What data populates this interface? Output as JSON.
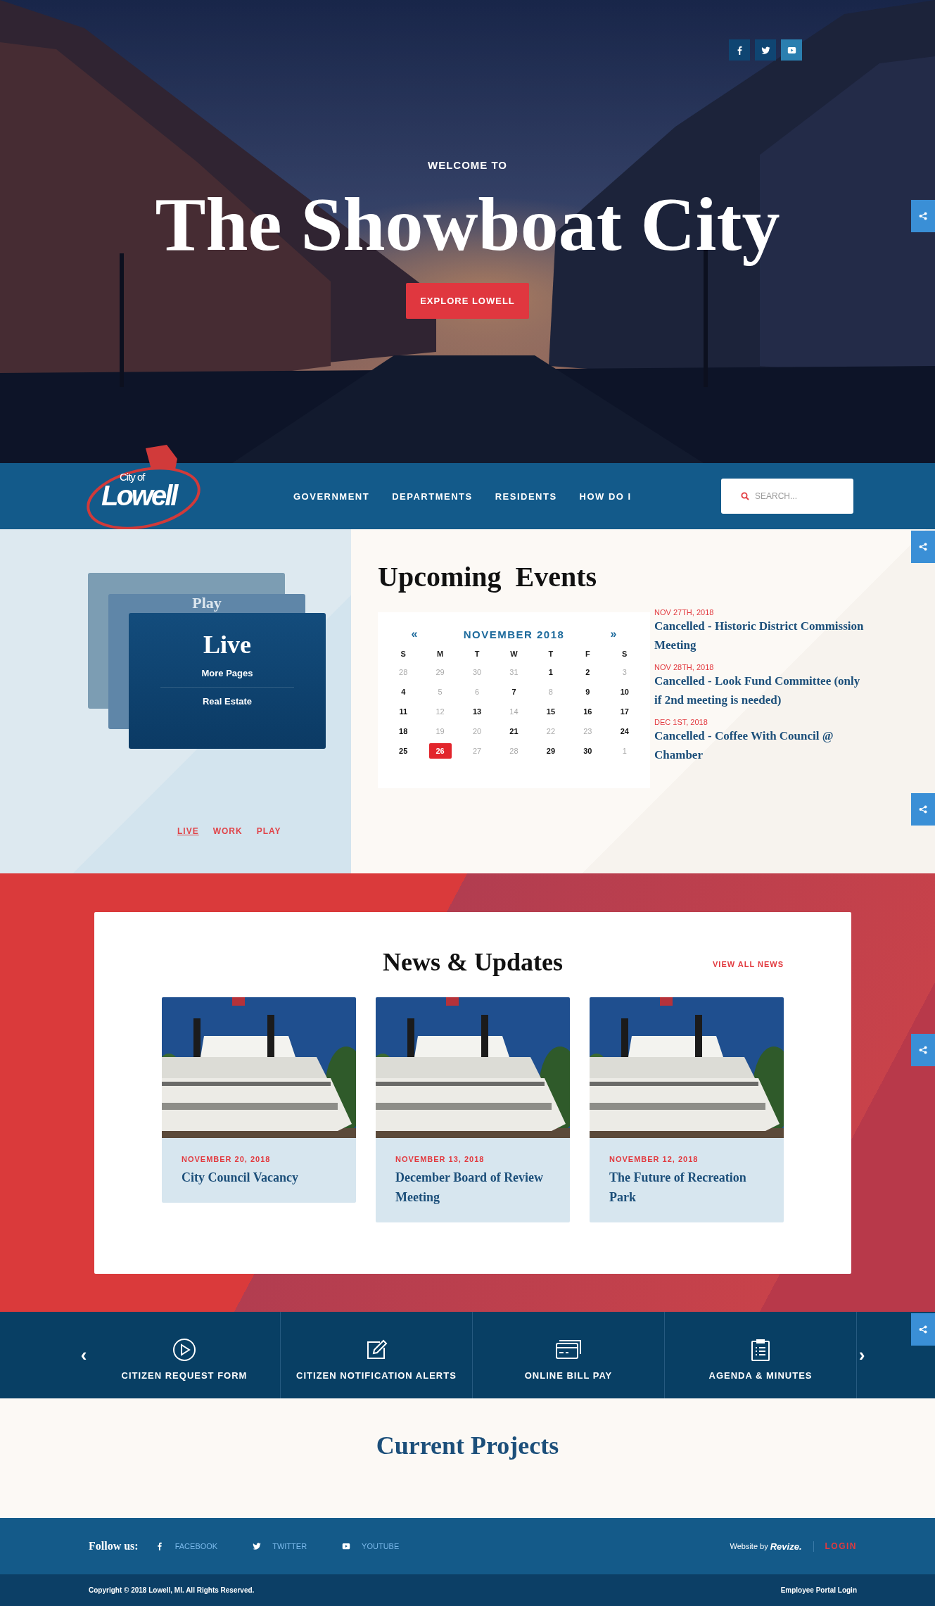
{
  "hero": {
    "social": [
      {
        "kind": "facebook"
      },
      {
        "kind": "twitter"
      },
      {
        "kind": "youtube"
      }
    ],
    "eyebrow": "WELCOME TO",
    "title": "The Showboat City",
    "button": "EXPLORE LOWELL"
  },
  "header": {
    "logo": {
      "small": "City of",
      "large": "Lowell"
    },
    "nav": [
      {
        "label": "GOVERNMENT"
      },
      {
        "label": "DEPARTMENTS"
      },
      {
        "label": "RESIDENTS"
      },
      {
        "label": "HOW DO I"
      }
    ],
    "search": {
      "placeholder": "SEARCH..."
    }
  },
  "explore": {
    "back_card_title": "Play",
    "front_card": {
      "title": "Live",
      "links": [
        "More Pages",
        "Real Estate"
      ]
    },
    "tabs": [
      {
        "label": "LIVE",
        "selected": true
      },
      {
        "label": "WORK",
        "selected": false
      },
      {
        "label": "PLAY",
        "selected": false
      }
    ]
  },
  "events": {
    "title": "Upcoming  Events",
    "calendar": {
      "prev": "«",
      "month": "NOVEMBER 2018",
      "next": "»",
      "weekdays": [
        "S",
        "M",
        "T",
        "W",
        "T",
        "F",
        "S"
      ],
      "days": [
        {
          "day": "28",
          "has_events": false,
          "selected": false
        },
        {
          "day": "29",
          "has_events": false,
          "selected": false
        },
        {
          "day": "30",
          "has_events": false,
          "selected": false
        },
        {
          "day": "31",
          "has_events": false,
          "selected": false
        },
        {
          "day": "1",
          "has_events": true,
          "selected": false
        },
        {
          "day": "2",
          "has_events": true,
          "selected": false
        },
        {
          "day": "3",
          "has_events": false,
          "selected": false
        },
        {
          "day": "4",
          "has_events": true,
          "selected": false
        },
        {
          "day": "5",
          "has_events": false,
          "selected": false
        },
        {
          "day": "6",
          "has_events": false,
          "selected": false
        },
        {
          "day": "7",
          "has_events": true,
          "selected": false
        },
        {
          "day": "8",
          "has_events": false,
          "selected": false
        },
        {
          "day": "9",
          "has_events": true,
          "selected": false
        },
        {
          "day": "10",
          "has_events": true,
          "selected": false
        },
        {
          "day": "11",
          "has_events": true,
          "selected": false
        },
        {
          "day": "12",
          "has_events": false,
          "selected": false
        },
        {
          "day": "13",
          "has_events": true,
          "selected": false
        },
        {
          "day": "14",
          "has_events": false,
          "selected": false
        },
        {
          "day": "15",
          "has_events": true,
          "selected": false
        },
        {
          "day": "16",
          "has_events": true,
          "selected": false
        },
        {
          "day": "17",
          "has_events": true,
          "selected": false
        },
        {
          "day": "18",
          "has_events": true,
          "selected": false
        },
        {
          "day": "19",
          "has_events": false,
          "selected": false
        },
        {
          "day": "20",
          "has_events": false,
          "selected": false
        },
        {
          "day": "21",
          "has_events": true,
          "selected": false
        },
        {
          "day": "22",
          "has_events": false,
          "selected": false
        },
        {
          "day": "23",
          "has_events": false,
          "selected": false
        },
        {
          "day": "24",
          "has_events": true,
          "selected": false
        },
        {
          "day": "25",
          "has_events": true,
          "selected": false
        },
        {
          "day": "26",
          "has_events": true,
          "selected": true
        },
        {
          "day": "27",
          "has_events": false,
          "selected": false
        },
        {
          "day": "28",
          "has_events": false,
          "selected": false
        },
        {
          "day": "29",
          "has_events": true,
          "selected": false
        },
        {
          "day": "30",
          "has_events": true,
          "selected": false
        },
        {
          "day": "1",
          "has_events": false,
          "selected": false
        }
      ]
    },
    "items": [
      {
        "date": "NOV 27TH, 2018",
        "title": "Cancelled - Historic District Commission Meeting"
      },
      {
        "date": "NOV 28TH, 2018",
        "title": "Cancelled - Look Fund Committee (only if 2nd meeting is needed)"
      },
      {
        "date": "DEC 1ST, 2018",
        "title": "Cancelled - Coffee With Council @ Chamber"
      }
    ]
  },
  "news": {
    "title": "News & Updates",
    "view_all": "VIEW ALL NEWS",
    "articles": [
      {
        "date": "NOVEMBER 20, 2018",
        "title": "City Council Vacancy"
      },
      {
        "date": "NOVEMBER 13, 2018",
        "title": "December Board of Review Meeting"
      },
      {
        "date": "NOVEMBER 12, 2018",
        "title": "The Future of Recreation Park"
      }
    ]
  },
  "quick_links": {
    "prev": "‹",
    "next": "›",
    "items": [
      {
        "kind": "play",
        "label": "CITIZEN REQUEST FORM"
      },
      {
        "kind": "edit",
        "label": "CITIZEN NOTIFICATION ALERTS"
      },
      {
        "kind": "card",
        "label": "ONLINE BILL PAY"
      },
      {
        "kind": "clipboard",
        "label": "AGENDA & MINUTES"
      }
    ]
  },
  "projects": {
    "title": "Current Projects"
  },
  "footer": {
    "follow_label": "Follow us:",
    "social": [
      {
        "kind": "facebook",
        "label": "FACEBOOK"
      },
      {
        "kind": "twitter",
        "label": "TWITTER"
      },
      {
        "kind": "youtube",
        "label": "YOUTUBE"
      }
    ],
    "credit": "Website by",
    "brand": "Revize.",
    "login": "LOGIN",
    "copyright": "Copyright © 2018 Lowell, MI. All Rights Reserved.",
    "employee_login": "Employee Portal Login"
  },
  "share_buttons": [
    {
      "kind": "share"
    },
    {
      "kind": "share"
    },
    {
      "kind": "share"
    },
    {
      "kind": "share"
    },
    {
      "kind": "share"
    }
  ]
}
